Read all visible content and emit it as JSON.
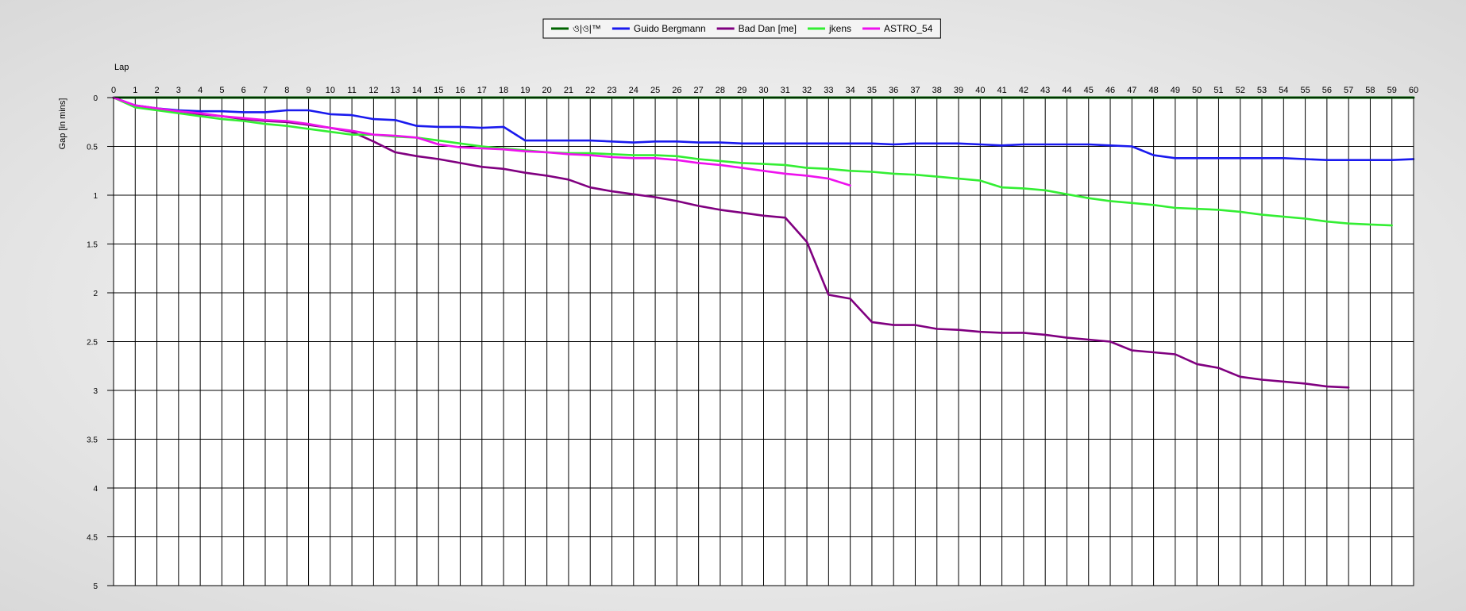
{
  "chart_data": {
    "type": "line",
    "xlabel": "Lap",
    "ylabel": "Gap [in mins]",
    "xlim": [
      0,
      60
    ],
    "ylim": [
      0,
      5
    ],
    "y_inverted": true,
    "x_ticks": [
      0,
      1,
      2,
      3,
      4,
      5,
      6,
      7,
      8,
      9,
      10,
      11,
      12,
      13,
      14,
      15,
      16,
      17,
      18,
      19,
      20,
      21,
      22,
      23,
      24,
      25,
      26,
      27,
      28,
      29,
      30,
      31,
      32,
      33,
      34,
      35,
      36,
      37,
      38,
      39,
      40,
      41,
      42,
      43,
      44,
      45,
      46,
      47,
      48,
      49,
      50,
      51,
      52,
      53,
      54,
      55,
      56,
      57,
      58,
      59,
      60
    ],
    "y_ticks": [
      0,
      0.5,
      1,
      1.5,
      2,
      2.5,
      3,
      3.5,
      4,
      4.5,
      5
    ],
    "y_tick_labels": [
      "0",
      "0.5",
      "1",
      "1.5",
      "2",
      "2.5",
      "3",
      "3.5",
      "4",
      "4.5",
      "5"
    ],
    "grid": true,
    "legend_position": "top-center",
    "series": [
      {
        "name": "ও|ও|™",
        "color": "#006400",
        "x": [
          0,
          60
        ],
        "y": [
          0,
          0
        ]
      },
      {
        "name": "Guido Bergmann",
        "color": "#1a1aee",
        "x": [
          0,
          1,
          2,
          3,
          4,
          5,
          6,
          7,
          8,
          9,
          10,
          11,
          12,
          13,
          14,
          15,
          16,
          17,
          18,
          19,
          20,
          21,
          22,
          23,
          24,
          25,
          26,
          27,
          28,
          29,
          30,
          31,
          32,
          33,
          34,
          35,
          36,
          37,
          38,
          39,
          40,
          41,
          42,
          43,
          44,
          45,
          46,
          47,
          48,
          49,
          50,
          51,
          52,
          53,
          54,
          55,
          56,
          57,
          58,
          59,
          60
        ],
        "y": [
          0,
          0.08,
          0.11,
          0.13,
          0.14,
          0.14,
          0.15,
          0.15,
          0.13,
          0.13,
          0.17,
          0.18,
          0.22,
          0.23,
          0.29,
          0.3,
          0.3,
          0.31,
          0.3,
          0.44,
          0.44,
          0.44,
          0.44,
          0.45,
          0.46,
          0.45,
          0.45,
          0.46,
          0.46,
          0.47,
          0.47,
          0.47,
          0.47,
          0.47,
          0.47,
          0.47,
          0.48,
          0.47,
          0.47,
          0.47,
          0.48,
          0.49,
          0.48,
          0.48,
          0.48,
          0.48,
          0.49,
          0.5,
          0.59,
          0.62,
          0.62,
          0.62,
          0.62,
          0.62,
          0.62,
          0.63,
          0.64,
          0.64,
          0.64,
          0.64,
          0.63
        ]
      },
      {
        "name": "Bad Dan [me]",
        "color": "#800080",
        "x": [
          0,
          1,
          2,
          3,
          4,
          5,
          6,
          7,
          8,
          9,
          10,
          11,
          12,
          13,
          14,
          15,
          16,
          17,
          18,
          19,
          20,
          21,
          22,
          23,
          24,
          25,
          26,
          27,
          28,
          29,
          30,
          31,
          32,
          33,
          34,
          35,
          36,
          37,
          38,
          39,
          40,
          41,
          42,
          43,
          44,
          45,
          46,
          47,
          48,
          49,
          50,
          51,
          52,
          53,
          54,
          55,
          56,
          57
        ],
        "y": [
          0,
          0.09,
          0.12,
          0.14,
          0.17,
          0.19,
          0.22,
          0.24,
          0.25,
          0.28,
          0.31,
          0.35,
          0.45,
          0.56,
          0.6,
          0.63,
          0.67,
          0.71,
          0.73,
          0.77,
          0.8,
          0.84,
          0.92,
          0.96,
          0.99,
          1.02,
          1.06,
          1.11,
          1.15,
          1.18,
          1.21,
          1.23,
          1.48,
          2.02,
          2.06,
          2.3,
          2.33,
          2.33,
          2.37,
          2.38,
          2.4,
          2.41,
          2.41,
          2.43,
          2.46,
          2.48,
          2.5,
          2.59,
          2.61,
          2.63,
          2.73,
          2.77,
          2.86,
          2.89,
          2.91,
          2.93,
          2.96,
          2.97
        ]
      },
      {
        "name": "jkens",
        "color": "#33ee33",
        "x": [
          0,
          1,
          2,
          3,
          4,
          5,
          6,
          7,
          8,
          9,
          10,
          11,
          12,
          13,
          14,
          15,
          16,
          17,
          18,
          19,
          20,
          21,
          22,
          23,
          24,
          25,
          26,
          27,
          28,
          29,
          30,
          31,
          32,
          33,
          34,
          35,
          36,
          37,
          38,
          39,
          40,
          41,
          42,
          43,
          44,
          45,
          46,
          47,
          48,
          49,
          50,
          51,
          52,
          53,
          54,
          55,
          56,
          57,
          58,
          59
        ],
        "y": [
          0,
          0.1,
          0.13,
          0.16,
          0.19,
          0.22,
          0.24,
          0.27,
          0.29,
          0.32,
          0.35,
          0.38,
          0.38,
          0.4,
          0.41,
          0.44,
          0.47,
          0.5,
          0.52,
          0.54,
          0.56,
          0.57,
          0.57,
          0.58,
          0.59,
          0.59,
          0.6,
          0.63,
          0.65,
          0.67,
          0.68,
          0.69,
          0.72,
          0.73,
          0.75,
          0.76,
          0.78,
          0.79,
          0.81,
          0.83,
          0.85,
          0.92,
          0.93,
          0.95,
          0.99,
          1.03,
          1.06,
          1.08,
          1.1,
          1.13,
          1.14,
          1.15,
          1.17,
          1.2,
          1.22,
          1.24,
          1.27,
          1.29,
          1.3,
          1.31
        ]
      },
      {
        "name": "ASTRO_54",
        "color": "#ee11ee",
        "x": [
          0,
          1,
          2,
          3,
          4,
          5,
          6,
          7,
          8,
          9,
          10,
          11,
          12,
          13,
          14,
          15,
          16,
          17,
          18,
          19,
          20,
          21,
          22,
          23,
          24,
          25,
          26,
          27,
          28,
          29,
          30,
          31,
          32,
          33,
          34
        ],
        "y": [
          0,
          0.08,
          0.11,
          0.14,
          0.16,
          0.19,
          0.21,
          0.23,
          0.24,
          0.27,
          0.31,
          0.34,
          0.38,
          0.39,
          0.41,
          0.48,
          0.51,
          0.52,
          0.53,
          0.55,
          0.56,
          0.58,
          0.59,
          0.61,
          0.62,
          0.62,
          0.64,
          0.67,
          0.69,
          0.72,
          0.75,
          0.78,
          0.8,
          0.83,
          0.9
        ]
      }
    ]
  }
}
